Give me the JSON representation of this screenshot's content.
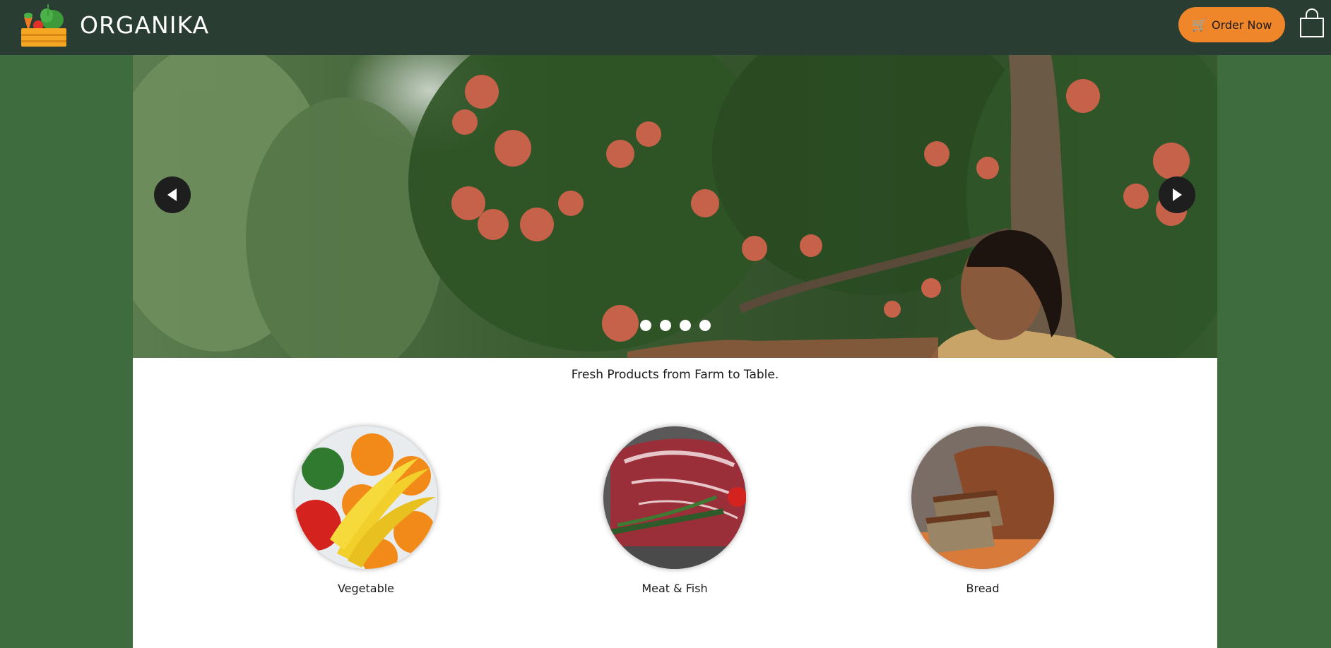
{
  "header": {
    "brand": "ORGANIKA",
    "order_label": "Order Now",
    "order_icon": "🛒"
  },
  "hero": {
    "slide_count": 4,
    "active_slide": 1
  },
  "tagline": "Fresh Products from Farm to Table.",
  "categories": [
    {
      "label": "Vegetable"
    },
    {
      "label": "Meat & Fish"
    },
    {
      "label": "Bread"
    }
  ],
  "colors": {
    "header_bg": "#2a3d32",
    "page_bg": "#3f6c3e",
    "accent": "#f0862a"
  }
}
